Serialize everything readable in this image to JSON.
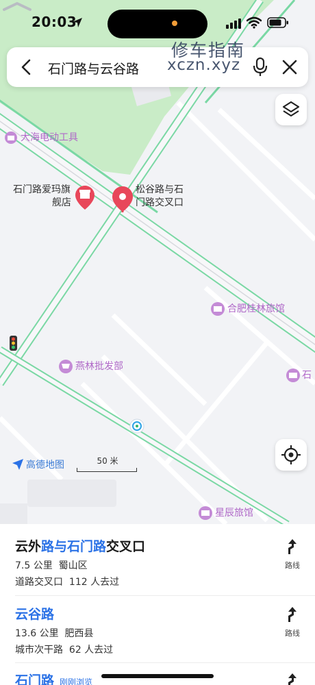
{
  "status_bar": {
    "time": "20:03"
  },
  "search": {
    "query": "石门路与云谷路"
  },
  "watermark": {
    "line1": "修车指南",
    "line2": "xczn.xyz"
  },
  "map": {
    "pois": {
      "dahai": "大海电动工具",
      "shop_line1": "石门路爱玛旗",
      "shop_line2": "舰店",
      "pin_line1": "松谷路与石",
      "pin_line2": "门路交叉口",
      "hefei_guilin": "合肥桂林旅馆",
      "yanlin": "燕林批发部",
      "shi_edge": "石",
      "xingchen": "星辰旅馆"
    },
    "logo_text": "高德地图",
    "scale_text": "50 米"
  },
  "results": [
    {
      "title_parts": {
        "a": "云外",
        "b": "路与石门路",
        "c": "交叉口"
      },
      "distance": "7.5 公里",
      "district": "蜀山区",
      "category": "道路交叉口",
      "visitors": "112 人去过",
      "route_label": "路线"
    },
    {
      "title": "云谷路",
      "distance": "13.6 公里",
      "district": "肥西县",
      "category": "城市次干路",
      "visitors": "62 人去过",
      "route_label": "路线"
    },
    {
      "title": "石门路",
      "tag": "刚刚浏览"
    }
  ],
  "colors": {
    "road_green": "#7ad8a4",
    "park_green": "#c9ecc7",
    "pin_red": "#e8475a",
    "poi_purple": "#b069c8",
    "link_blue": "#2b72e6"
  }
}
